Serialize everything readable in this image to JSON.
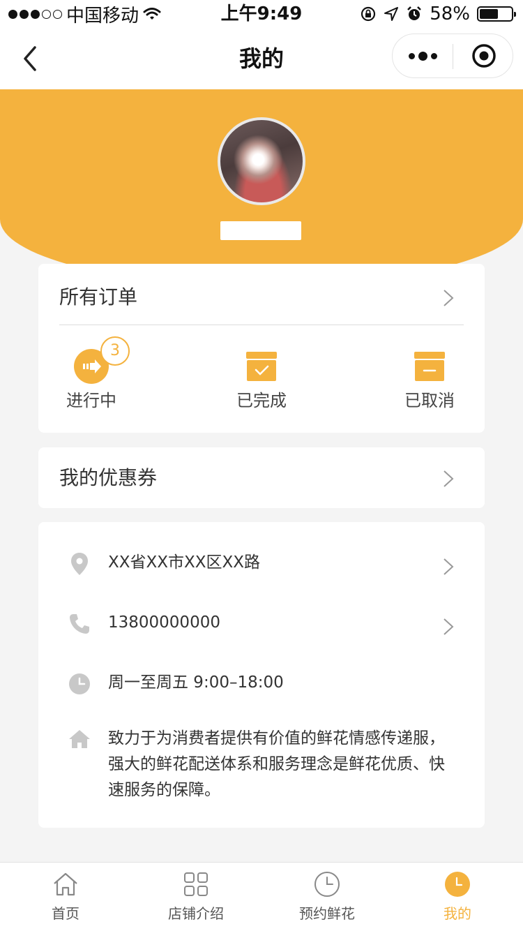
{
  "status_bar": {
    "carrier": "中国移动",
    "time": "上午9:49",
    "battery_percent": "58%",
    "battery_level": 0.58
  },
  "nav": {
    "title": "我的"
  },
  "orders": {
    "title": "所有订单",
    "statuses": [
      {
        "label": "进行中",
        "badge": "3",
        "icon": "in-progress-icon"
      },
      {
        "label": "已完成",
        "icon": "completed-box-icon"
      },
      {
        "label": "已取消",
        "icon": "cancelled-box-icon"
      }
    ]
  },
  "coupons": {
    "title": "我的优惠券"
  },
  "store_info": {
    "address": "XX省XX市XX区XX路",
    "phone": "13800000000",
    "hours": "周一至周五 9:00–18:00",
    "description": "致力于为消费者提供有价值的鲜花情感传递服，强大的鲜花配送体系和服务理念是鲜花优质、快速服务的保障。"
  },
  "tabs": [
    {
      "label": "首页",
      "icon": "home-icon"
    },
    {
      "label": "店铺介绍",
      "icon": "grid-icon"
    },
    {
      "label": "预约鲜花",
      "icon": "clock-icon"
    },
    {
      "label": "我的",
      "icon": "clock-filled-icon",
      "active": true
    }
  ],
  "colors": {
    "accent": "#f4b23e",
    "background": "#f4f4f4",
    "icon_gray": "#c8c8c8"
  }
}
